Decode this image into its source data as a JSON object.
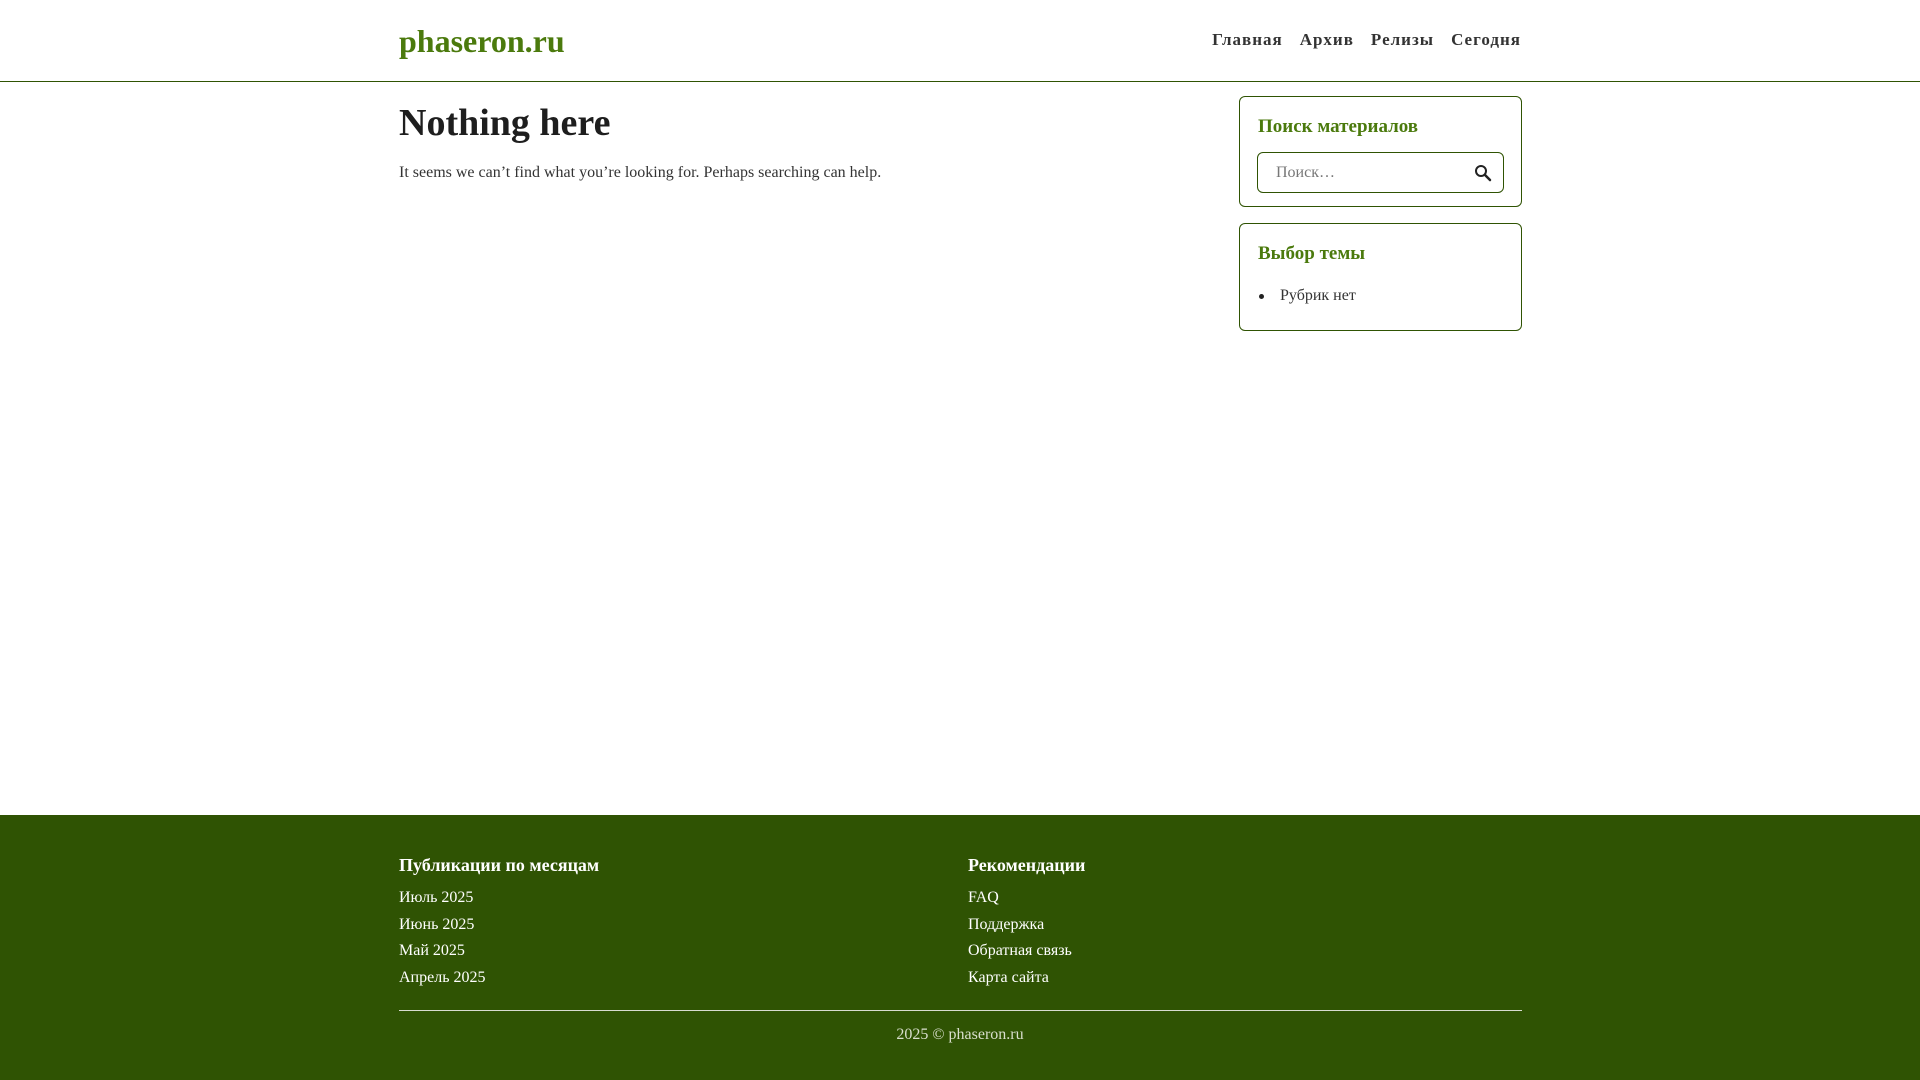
{
  "header": {
    "site_title": "phaseron.ru",
    "nav": [
      {
        "label": "Главная"
      },
      {
        "label": "Архив"
      },
      {
        "label": "Релизы"
      },
      {
        "label": "Сегодня"
      }
    ]
  },
  "main": {
    "title": "Nothing here",
    "text": "It seems we can’t find what you’re looking for. Perhaps searching can help."
  },
  "sidebar": {
    "search": {
      "title": "Поиск материалов",
      "placeholder": "Поиск…",
      "icon": "search-icon"
    },
    "categories": {
      "title": "Выбор темы",
      "items": [
        {
          "label": "Рубрик нет"
        }
      ]
    }
  },
  "footer": {
    "archive": {
      "title": "Публикации по месяцам",
      "links": [
        {
          "label": "Июль 2025"
        },
        {
          "label": "Июнь 2025"
        },
        {
          "label": "Май 2025"
        },
        {
          "label": "Апрель 2025"
        }
      ]
    },
    "recommendations": {
      "title": "Рекомендации",
      "links": [
        {
          "label": "FAQ"
        },
        {
          "label": "Поддержка"
        },
        {
          "label": "Обратная связь"
        },
        {
          "label": "Карта сайта"
        }
      ]
    },
    "copyright": "2025 © phaseron.ru"
  },
  "colors": {
    "brand_green": "#4b7a0d",
    "footer_bg": "#2f5303",
    "text": "#222222"
  }
}
